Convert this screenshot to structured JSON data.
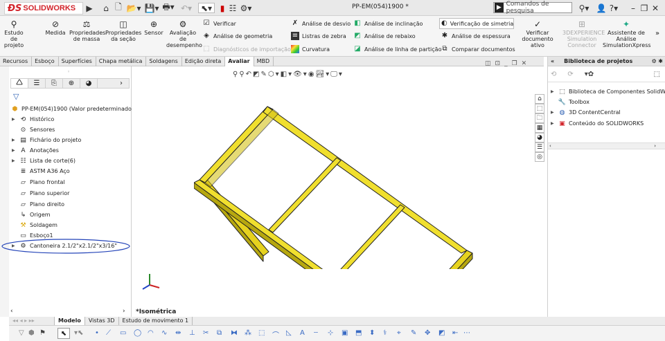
{
  "app": {
    "name": "SOLIDWORKS",
    "doc_title": "PP-EM(054)1900 *"
  },
  "search": {
    "placeholder": "Comandos de pesquisa"
  },
  "ribbon": {
    "large": [
      {
        "label": "Estudo de projeto",
        "icon": "study-icon"
      },
      {
        "label": "Medida",
        "icon": "measure-icon"
      },
      {
        "label": "Propriedades de massa",
        "icon": "mass-icon"
      },
      {
        "label": "Propriedades da seção",
        "icon": "section-icon"
      },
      {
        "label": "Sensor",
        "icon": "sensor-icon"
      },
      {
        "label": "Avaliação de desempenho",
        "icon": "performance-icon"
      }
    ],
    "small": [
      {
        "label": "Verificar",
        "icon": "check-icon",
        "disabled": false
      },
      {
        "label": "Análise de geometria",
        "icon": "geometry-icon",
        "disabled": false
      },
      {
        "label": "Diagnósticos de importação",
        "icon": "import-icon",
        "disabled": true
      },
      {
        "label": "Análise de desvio",
        "icon": "deviation-icon",
        "disabled": false
      },
      {
        "label": "Listras de zebra",
        "icon": "zebra-icon",
        "disabled": false
      },
      {
        "label": "Curvatura",
        "icon": "curvature-icon",
        "disabled": false
      },
      {
        "label": "Análise de inclinação",
        "icon": "draft-icon",
        "disabled": false
      },
      {
        "label": "Análise de rebaixo",
        "icon": "undercut-icon",
        "disabled": false
      },
      {
        "label": "Análise de linha de partição",
        "icon": "parting-icon",
        "disabled": false
      },
      {
        "label": "Verificação de simetria",
        "icon": "symmetry-icon",
        "disabled": false
      },
      {
        "label": "Análise de espessura",
        "icon": "thickness-icon",
        "disabled": false
      },
      {
        "label": "Comparar documentos",
        "icon": "compare-icon",
        "disabled": false
      }
    ],
    "right": [
      {
        "label": "Verificar documento ativo",
        "disabled": false
      },
      {
        "label": "3DEXPERIENCE Simulation Connector",
        "disabled": true
      },
      {
        "label": "Assistente de Análise SimulationXpress",
        "disabled": false
      }
    ]
  },
  "tabs": [
    "Recursos",
    "Esboço",
    "Superfícies",
    "Chapa metálica",
    "Soldagens",
    "Edição direta",
    "Avaliar",
    "MBD"
  ],
  "active_tab": "Avaliar",
  "tree": {
    "root": "PP-EM(054)1900  (Valor predeterminado<",
    "items": [
      {
        "label": "Histórico",
        "icon": "history-icon",
        "expand": true
      },
      {
        "label": "Sensores",
        "icon": "sensor-icon",
        "expand": false
      },
      {
        "label": "Fichário do projeto",
        "icon": "binder-icon",
        "expand": true
      },
      {
        "label": "Anotações",
        "icon": "annotation-icon",
        "expand": true
      },
      {
        "label": "Lista de corte(6)",
        "icon": "cutlist-icon",
        "expand": true
      },
      {
        "label": "ASTM A36 Aço",
        "icon": "material-icon",
        "expand": false
      },
      {
        "label": "Plano frontal",
        "icon": "plane-icon",
        "expand": false
      },
      {
        "label": "Plano superior",
        "icon": "plane-icon",
        "expand": false
      },
      {
        "label": "Plano direito",
        "icon": "plane-icon",
        "expand": false
      },
      {
        "label": "Origem",
        "icon": "origin-icon",
        "expand": false
      },
      {
        "label": "Soldagem",
        "icon": "weldment-icon",
        "expand": false
      },
      {
        "label": "Esboço1",
        "icon": "sketch-icon",
        "expand": false
      },
      {
        "label": "Cantoneira 2.1/2\"x2.1/2\"x3/16\"",
        "icon": "structure-icon",
        "expand": true
      }
    ]
  },
  "viewport": {
    "view_label": "*Isométrica",
    "frame_color": "#e6d21e"
  },
  "library": {
    "title": "Biblioteca de projetos",
    "items": [
      {
        "label": "Biblioteca de Componentes SolidW",
        "icon": "library-icon"
      },
      {
        "label": "Toolbox",
        "icon": "toolbox-icon"
      },
      {
        "label": "3D ContentCentral",
        "icon": "content-central-icon"
      },
      {
        "label": "Conteúdo do SOLIDWORKS",
        "icon": "sw-content-icon"
      }
    ]
  },
  "bottom_tabs": [
    "Modelo",
    "Vistas 3D",
    "Estudo de movimento 1"
  ],
  "active_bottom_tab": "Modelo"
}
